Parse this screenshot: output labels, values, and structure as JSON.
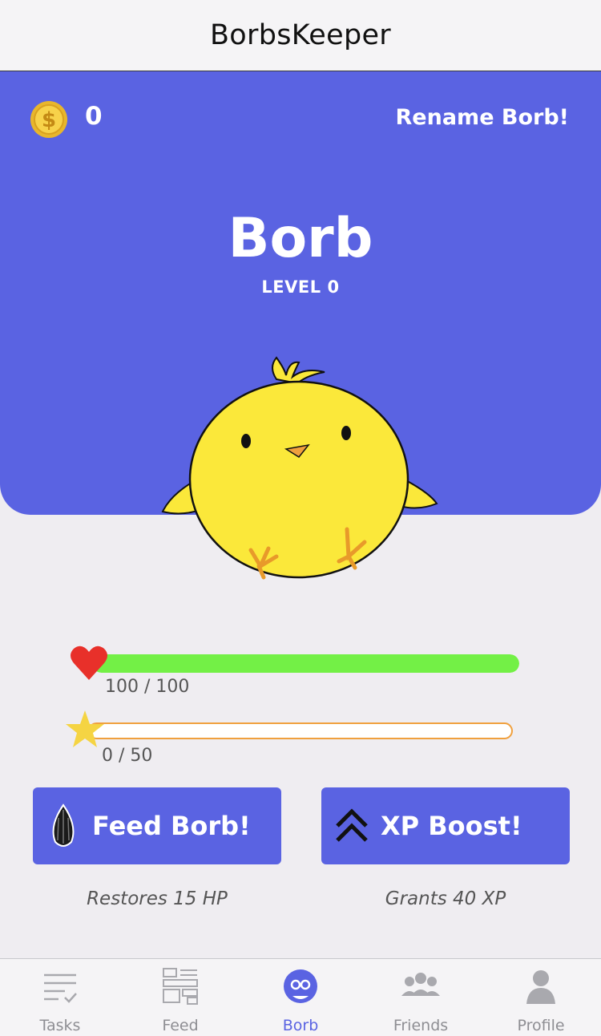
{
  "app": {
    "title": "BorbsKeeper"
  },
  "currency": {
    "coins": "0",
    "icon": "coin-icon"
  },
  "actions": {
    "rename_label": "Rename Borb!"
  },
  "borb": {
    "name": "Borb",
    "level_label": "LEVEL 0"
  },
  "stats": {
    "hp": {
      "text": "100 / 100",
      "current": 100,
      "max": 100,
      "color": "#73f046",
      "icon": "heart-icon"
    },
    "xp": {
      "text": "0 / 50",
      "current": 0,
      "max": 50,
      "color": "#f0a03e",
      "icon": "star-icon"
    }
  },
  "buttons": {
    "feed": {
      "label": "Feed Borb!",
      "subtitle": "Restores 15 HP",
      "icon": "seed-icon"
    },
    "boost": {
      "label": "XP Boost!",
      "subtitle": "Grants 40 XP",
      "icon": "double-chevron-up-icon"
    }
  },
  "tabs": [
    {
      "label": "Tasks",
      "icon": "tasks-icon",
      "active": false
    },
    {
      "label": "Feed",
      "icon": "feed-icon",
      "active": false
    },
    {
      "label": "Borb",
      "icon": "borb-icon",
      "active": true
    },
    {
      "label": "Friends",
      "icon": "friends-icon",
      "active": false
    },
    {
      "label": "Profile",
      "icon": "profile-icon",
      "active": false
    }
  ],
  "colors": {
    "accent": "#5a63e2",
    "background": "#efedf1",
    "chick": "#fbe83a"
  }
}
